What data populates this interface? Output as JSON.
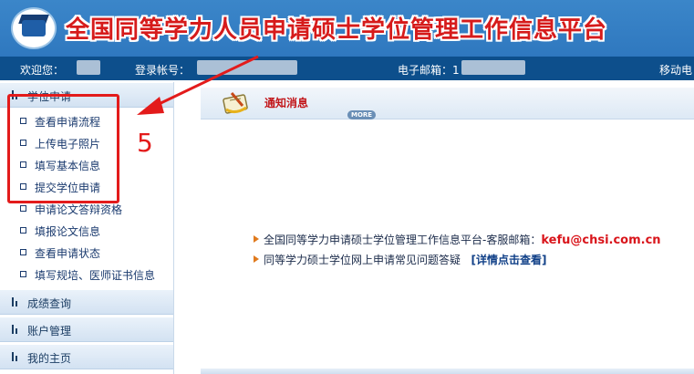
{
  "header": {
    "title": "全国同等学力人员申请硕士学位管理工作信息平台"
  },
  "userbar": {
    "welcome_label": "欢迎您：",
    "account_label": "登录帐号：",
    "email_label": "电子邮箱：1",
    "mobile_label": "移动电"
  },
  "sidebar": {
    "sections": [
      {
        "label": "学位申请",
        "items": [
          "查看申请流程",
          "上传电子照片",
          "填写基本信息",
          "提交学位申请",
          "申请论文答辩资格",
          "填报论文信息",
          "查看申请状态",
          "填写规培、医师证书信息"
        ]
      },
      {
        "label": "成绩查询"
      },
      {
        "label": "账户管理"
      },
      {
        "label": "我的主页"
      }
    ]
  },
  "annotation": {
    "step": "5",
    "color": "#e31b1b"
  },
  "notice": {
    "title": "通知消息",
    "more": "MORE",
    "line1_text": "全国同等学力申请硕士学位管理工作信息平台-客服邮箱：",
    "line1_email": "kefu@chsi.com.cn",
    "line2_text": "同等学力硕士学位网上申请常见问题答疑",
    "line2_link": "[详情点击查看]"
  },
  "colors": {
    "header_blue": "#2f78bf",
    "userbar_navy": "#0d4f8c",
    "title_red": "#d61b1b",
    "nav_text": "#1a3a6e"
  }
}
